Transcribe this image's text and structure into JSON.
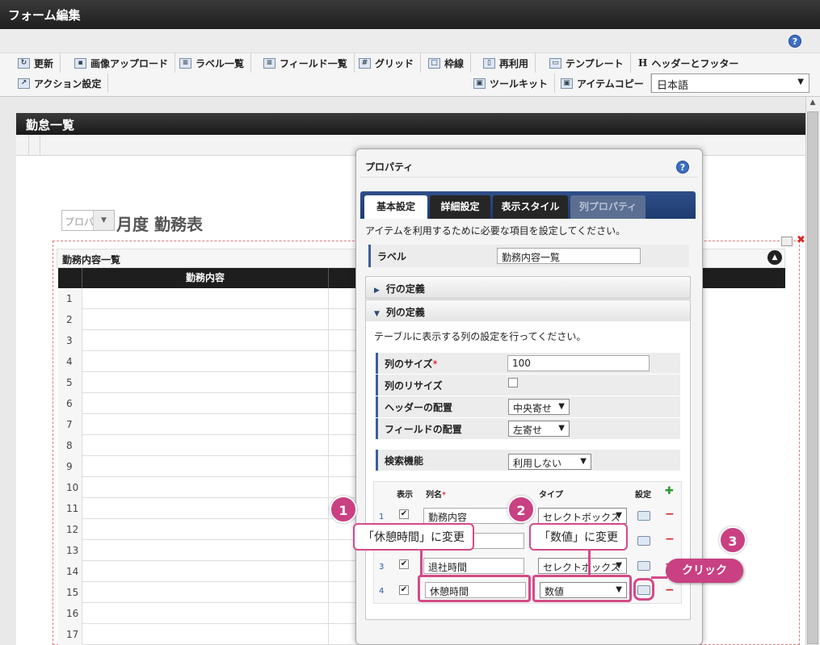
{
  "window": {
    "title": "フォーム編集",
    "help": "?"
  },
  "toolbar": {
    "update": "更新",
    "image_upload": "画像アップロード",
    "label_list": "ラベル一覧",
    "field_list": "フィールド一覧",
    "grid": "グリッド",
    "frame_line": "枠線",
    "reuse": "再利用",
    "template": "テンプレート",
    "header_footer": "ヘッダーとフッター",
    "action_settings": "アクション設定",
    "toolkit": "ツールキット",
    "item_copy": "アイテムコピー",
    "language": "日本語"
  },
  "form": {
    "header": "勤怠一覧",
    "month_select_placeholder": "プロパ",
    "month_label": "月度 勤務表",
    "table_title": "勤務内容一覧",
    "column_work": "勤務内容",
    "row_numbers": [
      "1",
      "2",
      "3",
      "4",
      "5",
      "6",
      "7",
      "8",
      "9",
      "10",
      "11",
      "12",
      "13",
      "14",
      "15",
      "16",
      "17"
    ]
  },
  "dialog": {
    "title": "プロパティ",
    "help": "?",
    "tabs": [
      "基本設定",
      "詳細設定",
      "表示スタイル",
      "列プロパティ"
    ],
    "description": "アイテムを利用するために必要な項目を設定してください。",
    "label_field": {
      "label": "ラベル",
      "value": "勤務内容一覧"
    },
    "row_def": "行の定義",
    "col_def": "列の定義",
    "col_desc": "テーブルに表示する列の設定を行ってください。",
    "col_size": {
      "label": "列のサイズ",
      "required": "*",
      "value": "100"
    },
    "col_resize": {
      "label": "列のリサイズ"
    },
    "header_align": {
      "label": "ヘッダーの配置",
      "value": "中央寄せ"
    },
    "field_align": {
      "label": "フィールドの配置",
      "value": "左寄せ"
    },
    "search": {
      "label": "検索機能",
      "value": "利用しない"
    },
    "columns_table": {
      "h_show": "表示",
      "h_name": "列名",
      "h_required": "*",
      "h_type": "タイプ",
      "h_setting": "設定",
      "rows": [
        {
          "num": "1",
          "name": "勤務内容",
          "type": "セレクトボックス"
        },
        {
          "num": "2",
          "name": "",
          "type": ""
        },
        {
          "num": "3",
          "name": "退社時間",
          "type": "セレクトボックス"
        },
        {
          "num": "4",
          "name": "休憩時間",
          "type": "数値"
        }
      ]
    }
  },
  "annotations": {
    "badge1": "1",
    "badge2": "2",
    "badge3": "3",
    "callout1": "「休憩時間」に変更",
    "callout2": "「数値」に変更",
    "click": "クリック",
    "accent_color": "#d44a88"
  }
}
